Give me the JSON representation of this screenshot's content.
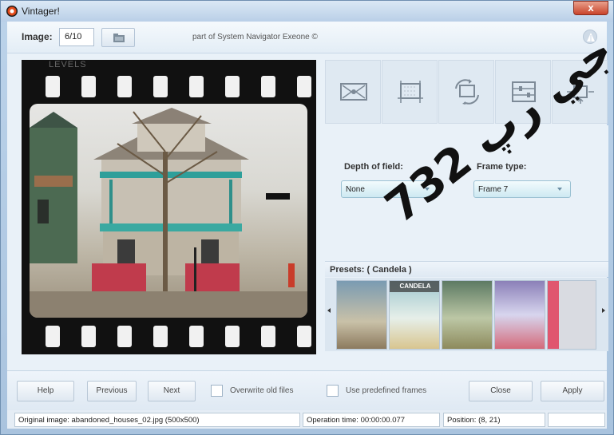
{
  "window": {
    "title": "Vintager!",
    "close_glyph": "x"
  },
  "topbar": {
    "image_label": "Image:",
    "image_value": "6/10",
    "subtitle": "part of System Navigator Exeone ©",
    "icons": {
      "open": "folder-open-icon",
      "logo": "app-logo-icon"
    }
  },
  "preview": {
    "levels_text": "LEVELS"
  },
  "tools": [
    {
      "icon": "frame-border-icon"
    },
    {
      "icon": "crop-icon"
    },
    {
      "icon": "rotate-image-icon"
    },
    {
      "icon": "adjust-sliders-icon"
    },
    {
      "icon": "resize-icon"
    }
  ],
  "options": {
    "depth_label": "Depth of field:",
    "depth_value": "None",
    "frame_label": "Frame type:",
    "frame_value": "Frame 7"
  },
  "presets": {
    "title": "Presets: ( Candela )",
    "thumb_label": "CANDELA"
  },
  "buttons": {
    "help": "Help",
    "previous": "Previous",
    "next": "Next",
    "overwrite_label": "Overwrite old files",
    "predefined_label": "Use predefined frames",
    "close": "Close",
    "apply": "Apply"
  },
  "status": {
    "original": "Original image: abandoned_houses_02.jpg (500x500)",
    "operation": "Operation time: 00:00:00.077",
    "position": "Position: (8, 21)",
    "extra": ""
  },
  "watermark": "732 جي رپ"
}
